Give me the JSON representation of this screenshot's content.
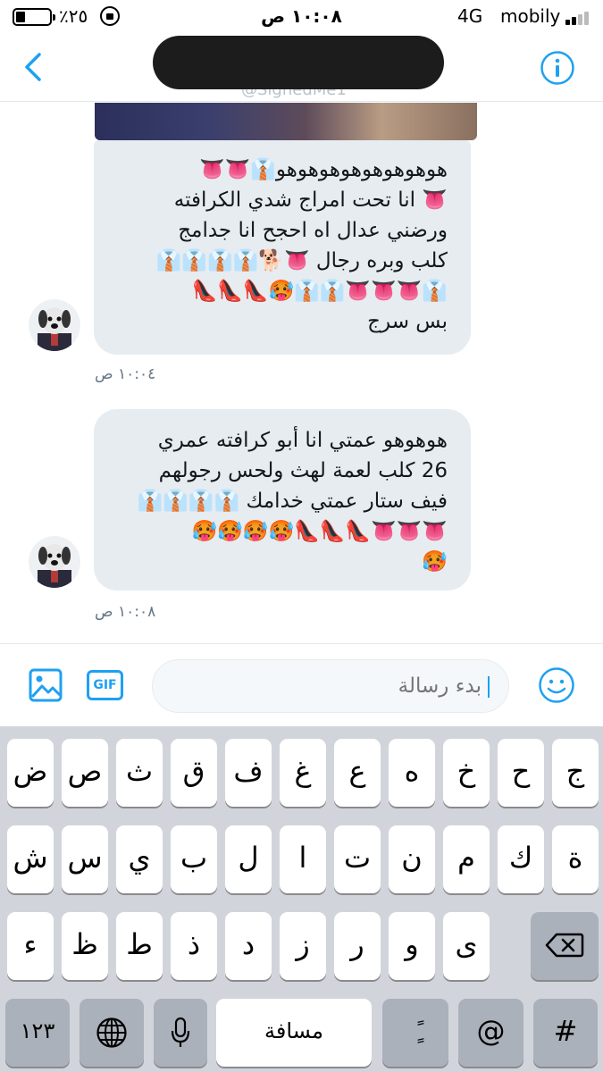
{
  "status_bar": {
    "battery_percent": "٪٢٥",
    "time": "١٠:٠٨ ص",
    "network": "4G",
    "carrier": "mobily"
  },
  "header": {
    "title": "",
    "handle": "@SignedMe1"
  },
  "messages": [
    {
      "lines": [
        "هوهوهوهوهوهوهوهو👔👅👅",
        "👅 انا تحت امراج شدي الكرافته",
        "ورضني عدال اه احجح انا جدامج",
        "كلب وبره رجال 👅🐕👔👔👔👔",
        "👔👅👅👅👔👔🥵👠👠👠",
        "بس سرج"
      ],
      "time": "١٠:٠٤ ص"
    },
    {
      "lines": [
        "هوهوهو عمتي انا أبو كرافته عمري",
        "26 كلب لعمة لهث ولحس رجولهم",
        "فيف ستار عمتي خدامك 👔👔👔👔",
        "👅👅👅👠👠👠🥵🥵🥵🥵",
        "🥵"
      ],
      "time": "١٠:٠٨ ص"
    }
  ],
  "composer": {
    "placeholder": "بدء رسالة",
    "gif_label": "GIF"
  },
  "keyboard": {
    "row1": [
      "ج",
      "ح",
      "خ",
      "ه",
      "ع",
      "غ",
      "ف",
      "ق",
      "ث",
      "ص",
      "ض"
    ],
    "row2": [
      "ة",
      "ك",
      "م",
      "ن",
      "ت",
      "ا",
      "ل",
      "ب",
      "ي",
      "س",
      "ش"
    ],
    "row3": [
      "ى",
      "و",
      "ر",
      "ز",
      "د",
      "ذ",
      "ط",
      "ظ",
      "ء"
    ],
    "numbers_label": "١٢٣",
    "space_label": "مسافة",
    "diacritic_label": "ًٍ",
    "at_label": "@",
    "hash_label": "#"
  }
}
